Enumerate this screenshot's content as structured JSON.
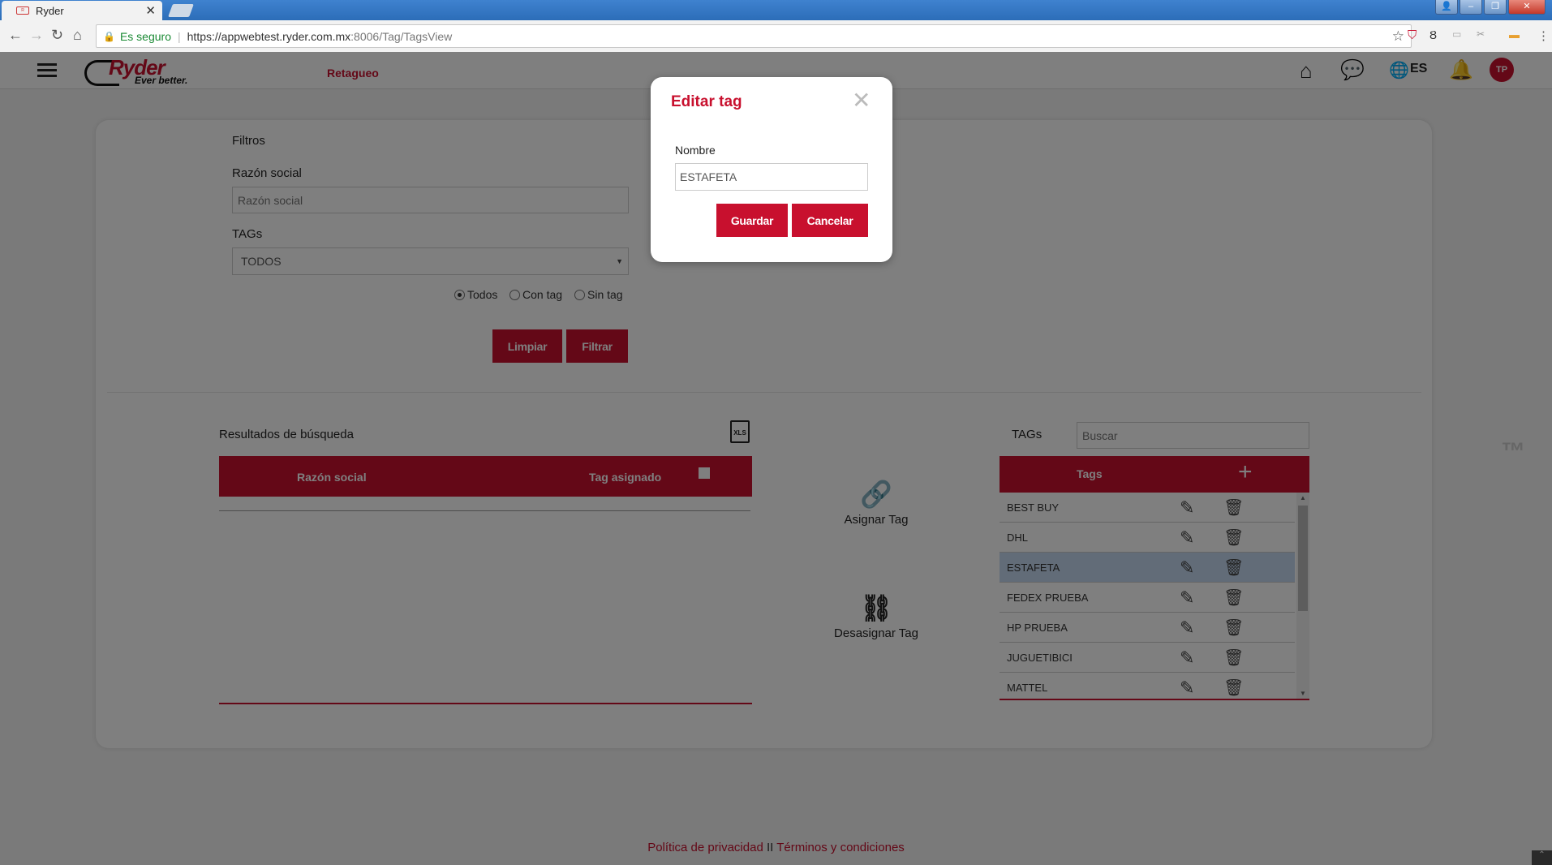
{
  "browser": {
    "tab_title": "Ryder",
    "secure_label": "Es seguro",
    "url_host": "https://appwebtest.ryder.com.mx",
    "url_path": ":8006/Tag/TagsView"
  },
  "header": {
    "logo_name": "Ryder",
    "logo_tagline": "Ever better.",
    "page_title": "Retagueo",
    "language": "ES",
    "avatar_initials": "TP"
  },
  "filters": {
    "title": "Filtros",
    "razon_label": "Razón social",
    "razon_placeholder": "Razón social",
    "tags_label": "TAGs",
    "tags_selected": "TODOS",
    "radio_options": [
      "Todos",
      "Con tag",
      "Sin tag"
    ],
    "limpiar": "Limpiar",
    "filtrar": "Filtrar"
  },
  "results": {
    "title": "Resultados de búsqueda",
    "xls_label": "XLS",
    "col_razon": "Razón social",
    "col_tag": "Tag asignado"
  },
  "actions": {
    "asignar": "Asignar Tag",
    "desasignar": "Desasignar Tag"
  },
  "tags": {
    "label": "TAGs",
    "search_placeholder": "Buscar",
    "header": "Tags",
    "items": [
      "BEST BUY",
      "DHL",
      "ESTAFETA",
      "FEDEX PRUEBA",
      "HP PRUEBA",
      "JUGUETIBICI",
      "MATTEL"
    ],
    "selected": "ESTAFETA"
  },
  "footer": {
    "privacy": "Política de privacidad",
    "separator": "II",
    "terms": "Términos y condiciones"
  },
  "modal": {
    "title": "Editar tag",
    "field_label": "Nombre",
    "field_value": "ESTAFETA",
    "save": "Guardar",
    "cancel": "Cancelar"
  },
  "colors": {
    "brand": "#c8102e",
    "selected_row": "#c5d9f1"
  }
}
